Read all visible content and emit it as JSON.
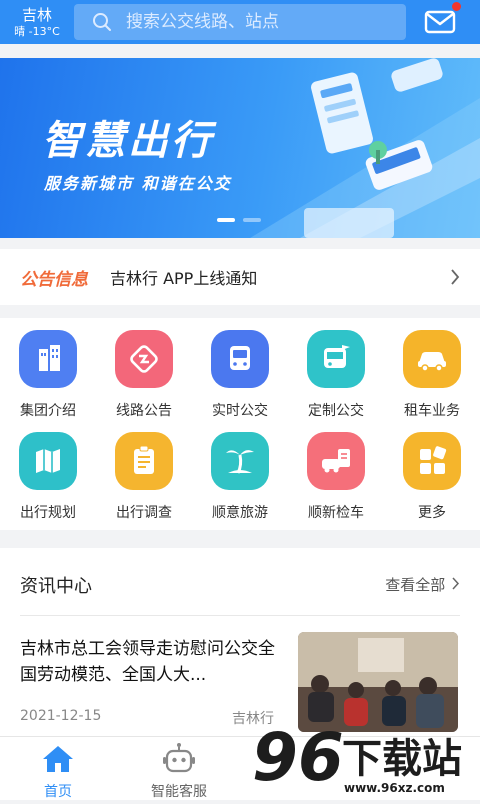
{
  "header": {
    "city": "吉林",
    "weather": "晴 -13°C",
    "search_placeholder": "搜索公交线路、站点",
    "mail_icon": "mail-icon"
  },
  "banner": {
    "title": "智慧出行",
    "subtitle": "服务新城市 和谐在公交"
  },
  "notice": {
    "tag": "公告信息",
    "text": "吉林行 APP上线通知"
  },
  "services": [
    {
      "label": "集团介绍",
      "icon": "building-icon",
      "color": "#4f7ff2"
    },
    {
      "label": "线路公告",
      "icon": "route-icon",
      "color": "#f3677a"
    },
    {
      "label": "实时公交",
      "icon": "bus-icon",
      "color": "#4b78ef"
    },
    {
      "label": "定制公交",
      "icon": "custom-bus-icon",
      "color": "#2fc3c9"
    },
    {
      "label": "租车业务",
      "icon": "car-icon",
      "color": "#f5b42a"
    },
    {
      "label": "出行规划",
      "icon": "map-icon",
      "color": "#2ec0c9"
    },
    {
      "label": "出行调查",
      "icon": "survey-icon",
      "color": "#f5b52f"
    },
    {
      "label": "顺意旅游",
      "icon": "palm-tree-icon",
      "color": "#30c3c5"
    },
    {
      "label": "顺新检车",
      "icon": "car-inspection-icon",
      "color": "#f56f7a"
    },
    {
      "label": "更多",
      "icon": "more-grid-icon",
      "color": "#f5b52c"
    }
  ],
  "news": {
    "title": "资讯中心",
    "more": "查看全部",
    "item": {
      "headline": "吉林市总工会领导走访慰问公交全国劳动模范、全国人大...",
      "date": "2021-12-15",
      "source": "吉林行"
    }
  },
  "tabs": [
    {
      "label": "首页",
      "icon": "home-icon",
      "active": true
    },
    {
      "label": "智能客服",
      "icon": "robot-icon",
      "active": false
    }
  ],
  "watermark": {
    "brand": "96下载站",
    "site": "www.96xz.com"
  },
  "colors": {
    "primary": "#2f8ef5",
    "accent_orange": "#f06b3a",
    "badge_red": "#f2362d"
  }
}
